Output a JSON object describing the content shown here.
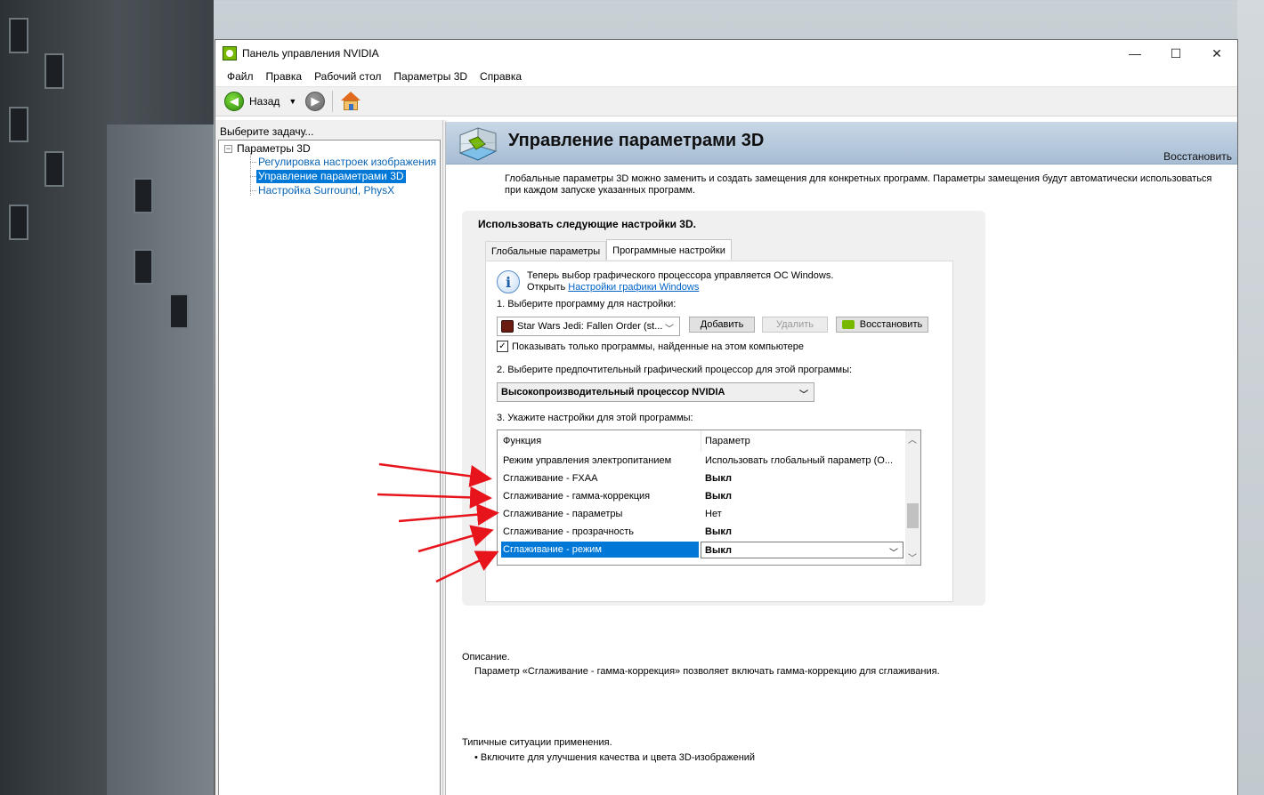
{
  "window": {
    "title": "Панель управления NVIDIA",
    "controls": {
      "minimize": "—",
      "maximize": "☐",
      "close": "✕"
    }
  },
  "menu": [
    "Файл",
    "Правка",
    "Рабочий стол",
    "Параметры 3D",
    "Справка"
  ],
  "toolbar": {
    "back_label": "Назад"
  },
  "left_panel": {
    "task_label": "Выберите задачу...",
    "tree_root": "Параметры 3D",
    "tree_items": [
      "Регулировка настроек изображения с пр",
      "Управление параметрами 3D",
      "Настройка Surround, PhysX"
    ],
    "selected_index": 1
  },
  "header": {
    "title": "Управление параметрами 3D",
    "restore": "Восстановить",
    "description": "Глобальные параметры 3D можно заменить и создать замещения для конкретных программ. Параметры замещения будут автоматически использоваться при каждом запуске указанных программ."
  },
  "group": {
    "title": "Использовать следующие настройки 3D.",
    "tabs": [
      "Глобальные параметры",
      "Программные настройки"
    ],
    "active_tab": 1
  },
  "info": {
    "line1": "Теперь выбор графического процессора управляется ОС Windows.",
    "line2_prefix": "Открыть ",
    "line2_link": "Настройки графики Windows"
  },
  "step1": {
    "label": "1. Выберите программу для настройки:",
    "program": "Star Wars Jedi: Fallen Order (st...",
    "add": "Добавить",
    "remove": "Удалить",
    "restore": "Восстановить",
    "checkbox_label": "Показывать только программы, найденные на этом компьютере",
    "checkbox_checked": true
  },
  "step2": {
    "label": "2. Выберите предпочтительный графический процессор для этой программы:",
    "value": "Высокопроизводительный процессор NVIDIA"
  },
  "step3": {
    "label": "3. Укажите настройки для этой программы:",
    "columns": [
      "Функция",
      "Параметр"
    ],
    "rows": [
      {
        "feature": "Режим управления электропитанием",
        "value": "Использовать глобальный параметр (О...",
        "bold": false
      },
      {
        "feature": "Сглаживание - FXAA",
        "value": "Выкл",
        "bold": true
      },
      {
        "feature": "Сглаживание - гамма-коррекция",
        "value": "Выкл",
        "bold": true
      },
      {
        "feature": "Сглаживание - параметры",
        "value": "Нет",
        "bold": false
      },
      {
        "feature": "Сглаживание - прозрачность",
        "value": "Выкл",
        "bold": true
      },
      {
        "feature": "Сглаживание - режим",
        "value": "Выкл",
        "bold": true
      }
    ],
    "selected_row": 5
  },
  "description": {
    "label": "Описание.",
    "text": "Параметр «Сглаживание - гамма-коррекция» позволяет включать гамма-коррекцию для сглаживания."
  },
  "typical": {
    "label": "Типичные ситуации применения.",
    "items": [
      "Включите для улучшения качества и цвета 3D-изображений"
    ]
  },
  "colors": {
    "accent": "#0078d7",
    "nvidia_green": "#76b900",
    "annotation_red": "#e8141c"
  }
}
